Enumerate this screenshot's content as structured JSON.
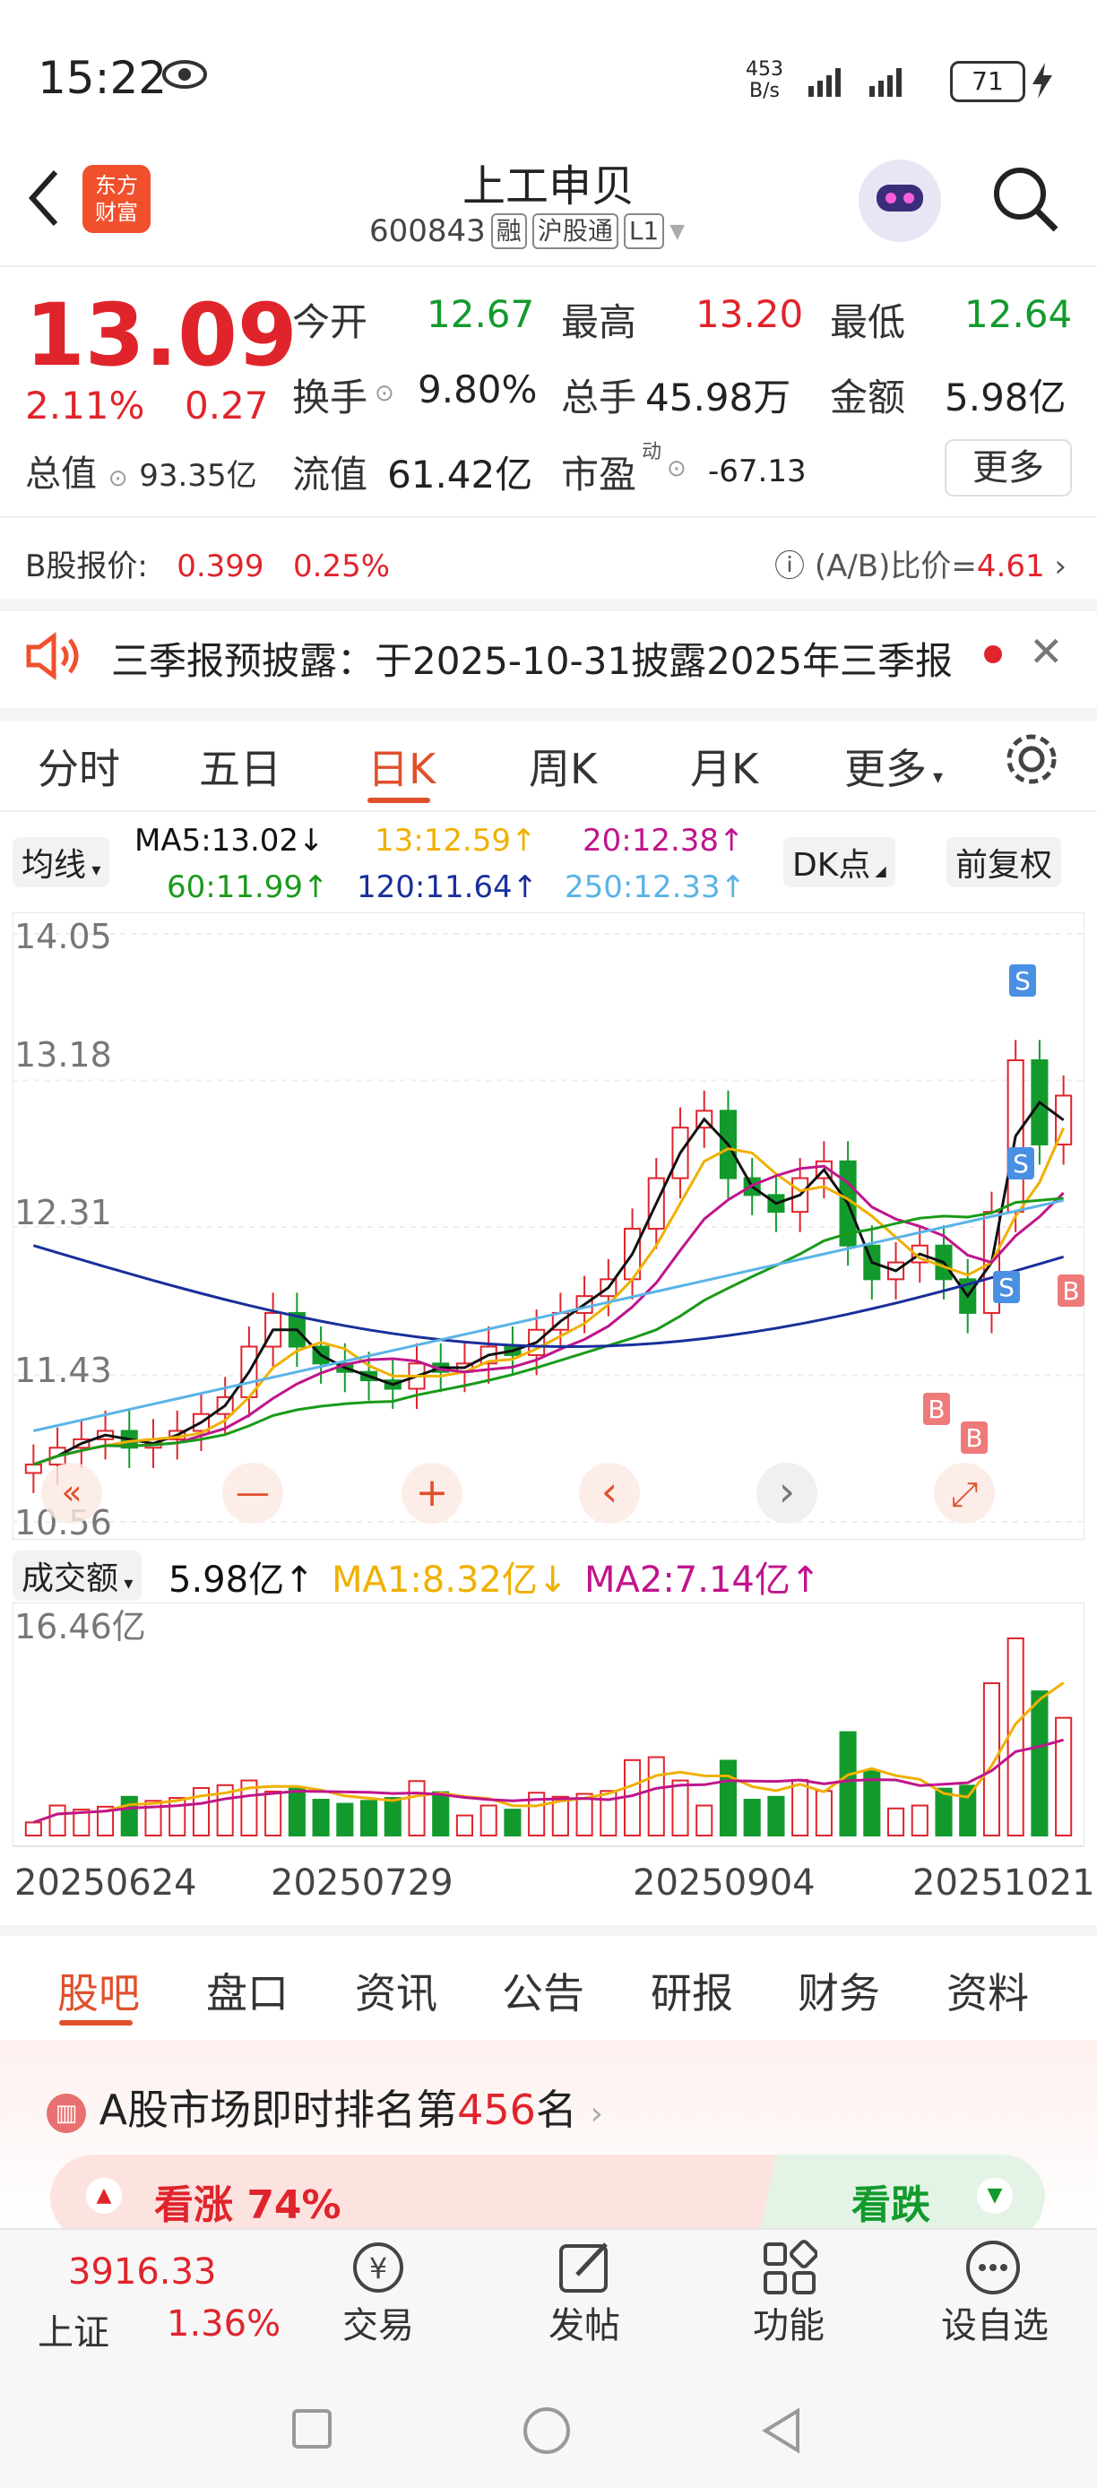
{
  "status_bar": {
    "time": "15:22",
    "net_speed_value": "453",
    "net_speed_unit": "B/s",
    "battery": "71"
  },
  "header": {
    "title": "上工申贝",
    "code": "600843",
    "tags": [
      "融",
      "沪股通",
      "L1"
    ],
    "logo_line1": "东方",
    "logo_line2": "财富"
  },
  "quote": {
    "price": "13.09",
    "change_pct": "2.11%",
    "change": "0.27",
    "open_label": "今开",
    "open": "12.67",
    "high_label": "最高",
    "high": "13.20",
    "low_label": "最低",
    "low": "12.64",
    "turnover_label": "换手",
    "turnover": "9.80%",
    "volume_label": "总手",
    "volume": "45.98万",
    "amount_label": "金额",
    "amount": "5.98亿",
    "mcap_label": "总值",
    "mcap": "93.35亿",
    "float_label": "流值",
    "float": "61.42亿",
    "pe_label": "市盈",
    "pe_sup": "动",
    "pe": "-67.13",
    "more": "更多"
  },
  "b_share": {
    "label": "B股报价:",
    "price": "0.399",
    "pct": "0.25%",
    "ratio_label": "(A/B)比价=",
    "ratio": "4.61"
  },
  "notice": {
    "text": "三季报预披露：于2025-10-31披露2025年三季报"
  },
  "kline_tabs": [
    "分时",
    "五日",
    "日K",
    "周K",
    "月K",
    "更多"
  ],
  "ma_legend": {
    "selector": "均线",
    "ma5": "MA5:13.02↓",
    "ma13": "13:12.59↑",
    "ma20": "20:12.38↑",
    "ma60": "60:11.99↑",
    "ma120": "120:11.64↑",
    "ma250": "250:12.33↑",
    "dk": "DK点",
    "adjust": "前复权",
    "colors": {
      "ma5": "#111111",
      "ma13": "#f0b000",
      "ma20": "#c0158c",
      "ma60": "#1a9a1a",
      "ma120": "#1a2f9a",
      "ma250": "#5ab4e6"
    }
  },
  "chart_data": {
    "type": "candlestick",
    "y_ticks": [
      "14.05",
      "13.18",
      "12.31",
      "11.43",
      "10.56"
    ],
    "ylim": [
      10.56,
      14.05
    ],
    "x_ticks": [
      "20250624",
      "20250729",
      "20250904",
      "20251021"
    ],
    "close_approx": [
      10.9,
      11.0,
      11.05,
      11.1,
      11.0,
      11.05,
      11.1,
      11.2,
      11.3,
      11.6,
      11.8,
      11.6,
      11.5,
      11.45,
      11.4,
      11.35,
      11.5,
      11.45,
      11.5,
      11.6,
      11.55,
      11.7,
      11.8,
      11.9,
      12.0,
      12.3,
      12.6,
      12.9,
      13.0,
      12.6,
      12.5,
      12.4,
      12.6,
      12.7,
      12.2,
      12.0,
      12.1,
      12.2,
      12.0,
      11.8,
      12.4,
      13.3,
      12.8,
      13.09
    ],
    "volume": {
      "label": "成交额",
      "value": "5.98亿↑",
      "ma1": "MA1:8.32亿↓",
      "ma2": "MA2:7.14亿↑",
      "ymax": "16.46亿"
    }
  },
  "chart_controls": [
    "«",
    "—",
    "+",
    "‹",
    "›",
    "⤢"
  ],
  "info_tabs": [
    "股吧",
    "盘口",
    "资讯",
    "公告",
    "研报",
    "财务",
    "资料"
  ],
  "rank": {
    "prefix": "A股市场即时排名第",
    "num": "456",
    "suffix": "名"
  },
  "sentiment": {
    "bull": "看涨 74%",
    "bear": "看跌"
  },
  "footer": {
    "index_value": "3916.33",
    "index_name": "上证",
    "index_pct": "1.36%",
    "items": [
      "交易",
      "发帖",
      "功能",
      "设自选"
    ]
  }
}
